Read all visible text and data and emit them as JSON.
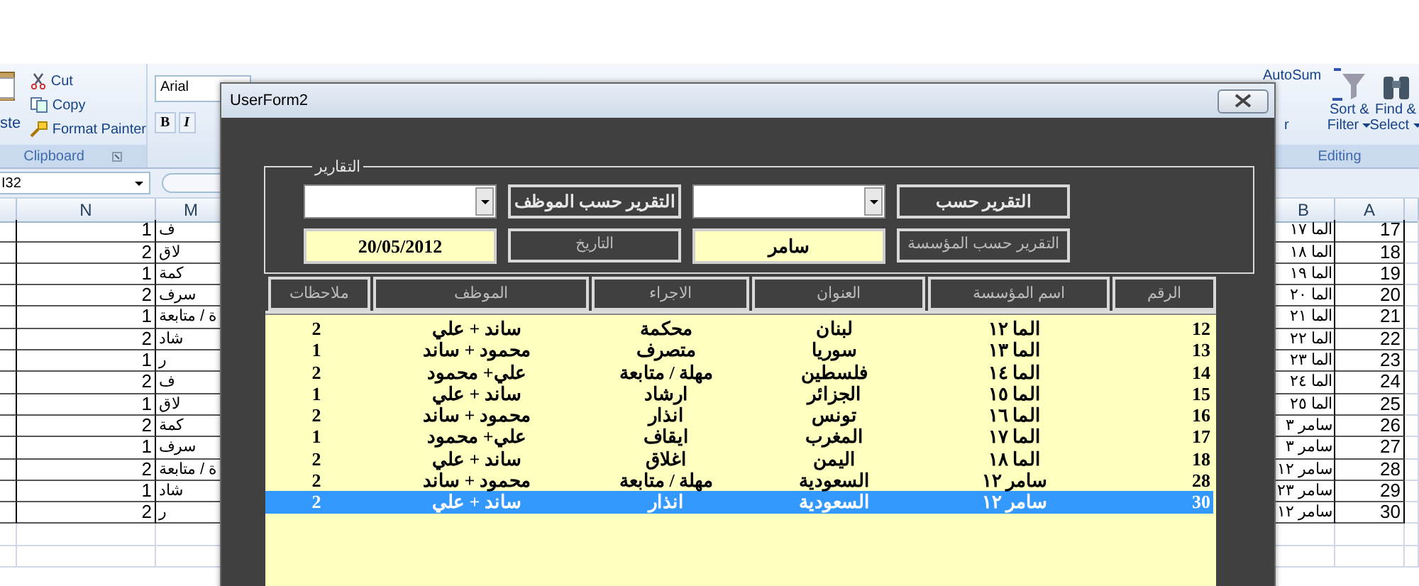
{
  "ribbon": {
    "paste_label": "ste",
    "clipboard_items": [
      "Cut",
      "Copy",
      "Format Painter"
    ],
    "clipboard_group": "Clipboard",
    "font_name": "Arial",
    "bold_button": "B",
    "italic_button": "I",
    "fragment": "r",
    "autosum": "AutoSum",
    "sort": [
      "Sort &",
      "Filter"
    ],
    "find": [
      "Find &",
      "Select"
    ],
    "editing_group": "Editing"
  },
  "name_box": "I32",
  "sheet": {
    "col_n": "N",
    "col_m": "M",
    "col_b": "B",
    "col_a": "A",
    "rows": [
      {
        "n": "1",
        "m": "ف",
        "b": "الما ١٧",
        "a": "17"
      },
      {
        "n": "2",
        "m": "لاق",
        "b": "الما ١٨",
        "a": "18"
      },
      {
        "n": "1",
        "m": "كمة",
        "b": "الما ١٩",
        "a": "19"
      },
      {
        "n": "2",
        "m": "سرف",
        "b": "الما ٢٠",
        "a": "20"
      },
      {
        "n": "1",
        "m": "ة / متابعة",
        "b": "الما ٢١",
        "a": "21"
      },
      {
        "n": "2",
        "m": "شاد",
        "b": "الما ٢٢",
        "a": "22"
      },
      {
        "n": "1",
        "m": "ر",
        "b": "الما ٢٣",
        "a": "23"
      },
      {
        "n": "2",
        "m": "ف",
        "b": "الما ٢٤",
        "a": "24"
      },
      {
        "n": "1",
        "m": "لاق",
        "b": "الما ٢٥",
        "a": "25"
      },
      {
        "n": "2",
        "m": "كمة",
        "b": "سامر ٣",
        "a": "26"
      },
      {
        "n": "1",
        "m": "سرف",
        "b": "سامر ٣",
        "a": "27"
      },
      {
        "n": "2",
        "m": "ة / متابعة",
        "b": "سامر ١٢",
        "a": "28"
      },
      {
        "n": "1",
        "m": "شاد",
        "b": "سامر ٢٣",
        "a": "29"
      },
      {
        "n": "2",
        "m": "ر",
        "b": "سامر ١٢",
        "a": "30"
      }
    ]
  },
  "form": {
    "title": "UserForm2",
    "frame_title": "التقارير",
    "filter_rows": [
      [
        {
          "kind": "label",
          "text": "التقرير حسب"
        },
        {
          "kind": "combo"
        },
        {
          "kind": "label",
          "text": "التقرير حسب الموظف"
        },
        {
          "kind": "combo"
        }
      ],
      [
        {
          "kind": "label",
          "text": "التقرير حسب المؤسسة"
        },
        {
          "kind": "field",
          "text": "سامر"
        },
        {
          "kind": "label",
          "text": "التاريخ"
        },
        {
          "kind": "field",
          "text": "20/05/2012"
        }
      ]
    ],
    "list": {
      "columns": [
        "الرقم",
        "اسم المؤسسة",
        "العنوان",
        "الاجراء",
        "الموظف",
        "ملاحظات"
      ],
      "rows": [
        {
          "cells": [
            "12",
            "الما ١٢",
            "لبنان",
            "محكمة",
            "ساند + علي",
            "2"
          ],
          "selected": false
        },
        {
          "cells": [
            "13",
            "الما ١٣",
            "سوريا",
            "متصرف",
            "محمود + ساند",
            "1"
          ],
          "selected": false
        },
        {
          "cells": [
            "14",
            "الما ١٤",
            "فلسطين",
            "مهلة / متابعة",
            "علي+ محمود",
            "2"
          ],
          "selected": false
        },
        {
          "cells": [
            "15",
            "الما ١٥",
            "الجزائر",
            "ارشاد",
            "ساند + علي",
            "1"
          ],
          "selected": false
        },
        {
          "cells": [
            "16",
            "الما ١٦",
            "تونس",
            "انذار",
            "محمود + ساند",
            "2"
          ],
          "selected": false
        },
        {
          "cells": [
            "17",
            "الما ١٧",
            "المغرب",
            "ايقاف",
            "علي+ محمود",
            "1"
          ],
          "selected": false
        },
        {
          "cells": [
            "18",
            "الما ١٨",
            "اليمن",
            "اغلاق",
            "ساند + علي",
            "2"
          ],
          "selected": false
        },
        {
          "cells": [
            "28",
            "سامر ١٢",
            "السعودية",
            "مهلة / متابعة",
            "محمود + ساند",
            "2"
          ],
          "selected": false
        },
        {
          "cells": [
            "30",
            "سامر ١٢",
            "السعودية",
            "انذار",
            "ساند + علي",
            "2"
          ],
          "selected": true
        }
      ]
    }
  }
}
